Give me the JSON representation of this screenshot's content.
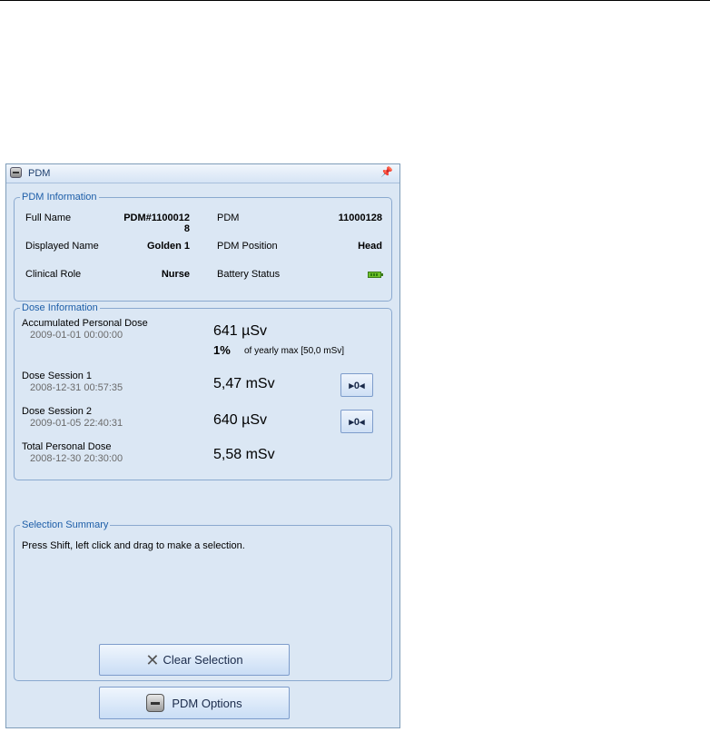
{
  "panel": {
    "title": "PDM",
    "pin_glyph": "⚓"
  },
  "pdm_info": {
    "legend": "PDM Information",
    "full_name_label": "Full Name",
    "full_name_value": "PDM#1100012\n8",
    "displayed_name_label": "Displayed Name",
    "displayed_name_value": "Golden 1",
    "clinical_role_label": "Clinical Role",
    "clinical_role_value": "Nurse",
    "pdm_label": "PDM",
    "pdm_value": "11000128",
    "pdm_position_label": "PDM Position",
    "pdm_position_value": "Head",
    "battery_status_label": "Battery Status",
    "battery_icon": "battery-full-icon"
  },
  "dose_info": {
    "legend": "Dose Information",
    "accumulated": {
      "label": "Accumulated Personal Dose",
      "time": "2009-01-01 00:00:00",
      "value": "641 µSv",
      "percent": "1%",
      "percent_note": "of yearly max [50,0 mSv]"
    },
    "session1": {
      "label": "Dose Session 1",
      "time": "2008-12-31 00:57:35",
      "value": "5,47 mSv",
      "button_glyph": "▸0◂"
    },
    "session2": {
      "label": "Dose Session 2",
      "time": "2009-01-05 22:40:31",
      "value": "640 µSv",
      "button_glyph": "▸0◂"
    },
    "total": {
      "label": "Total Personal Dose",
      "time": "2008-12-30 20:30:00",
      "value": "5,58 mSv"
    }
  },
  "selection": {
    "legend": "Selection Summary",
    "hint": "Press Shift, left click and drag to make a selection.",
    "clear_button": "Clear Selection"
  },
  "options_button": "PDM Options"
}
